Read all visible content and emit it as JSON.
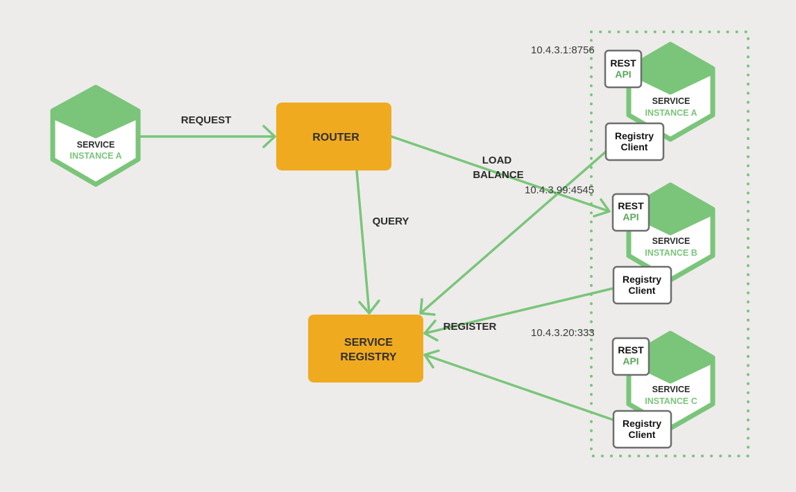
{
  "colors": {
    "background": "#edecea",
    "green": "#7ac57a",
    "orange": "#f0aa1f",
    "tag_border": "#6e6e6e",
    "text_dark": "#2b2b2b"
  },
  "client": {
    "title": "SERVICE",
    "subtitle": "INSTANCE A"
  },
  "router": {
    "label": "ROUTER"
  },
  "registry": {
    "line1": "SERVICE",
    "line2": "REGISTRY"
  },
  "edges": {
    "request": "REQUEST",
    "query": "QUERY",
    "load_balance_1": "LOAD",
    "load_balance_2": "BALANCE",
    "register": "REGISTER"
  },
  "instances": [
    {
      "address": "10.4.3.1:8756",
      "title": "SERVICE",
      "subtitle": "INSTANCE A",
      "api_line1": "REST",
      "api_line2": "API",
      "client_line1": "Registry",
      "client_line2": "Client"
    },
    {
      "address": "10.4.3.99:4545",
      "title": "SERVICE",
      "subtitle": "INSTANCE B",
      "api_line1": "REST",
      "api_line2": "API",
      "client_line1": "Registry",
      "client_line2": "Client"
    },
    {
      "address": "10.4.3.20:333",
      "title": "SERVICE",
      "subtitle": "INSTANCE C",
      "api_line1": "REST",
      "api_line2": "API",
      "client_line1": "Registry",
      "client_line2": "Client"
    }
  ]
}
